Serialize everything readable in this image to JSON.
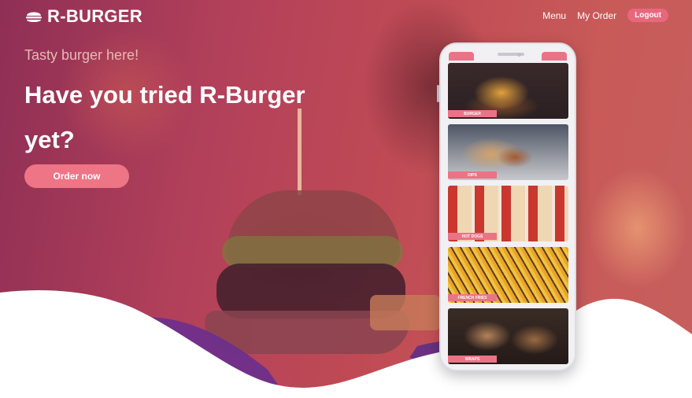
{
  "brand": {
    "name": "R-BURGER",
    "icon": "burger-icon"
  },
  "nav": {
    "menu_label": "Menu",
    "my_order_label": "My Order",
    "logout_label": "Logout"
  },
  "hero": {
    "tagline": "Tasty burger here!",
    "headline": "Have you tried R-Burger yet?",
    "cta_label": "Order now"
  },
  "phone": {
    "menu_items": [
      {
        "label": "BURGER"
      },
      {
        "label": "DIPS"
      },
      {
        "label": "HOT DOGS"
      },
      {
        "label": "FRENCH FRIES"
      },
      {
        "label": "WRAPS"
      }
    ]
  },
  "colors": {
    "accent": "#ee7585",
    "overlay": "#b2405a",
    "wave_purple": "#6a2f8e"
  }
}
